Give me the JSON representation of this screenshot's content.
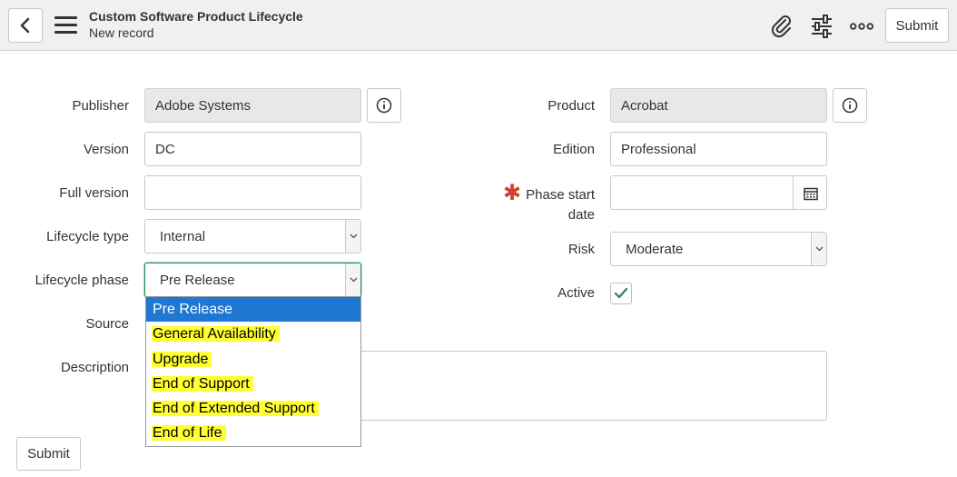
{
  "header": {
    "title": "Custom Software Product Lifecycle",
    "subtitle": "New record",
    "submit_label": "Submit"
  },
  "form": {
    "publisher": {
      "label": "Publisher",
      "value": "Adobe Systems"
    },
    "product": {
      "label": "Product",
      "value": "Acrobat"
    },
    "version": {
      "label": "Version",
      "value": "DC"
    },
    "edition": {
      "label": "Edition",
      "value": "Professional"
    },
    "full_version": {
      "label": "Full version",
      "value": ""
    },
    "phase_start_date": {
      "label_line1": "Phase start",
      "label_line2": "date",
      "value": ""
    },
    "lifecycle_type": {
      "label": "Lifecycle type",
      "value": "Internal"
    },
    "risk": {
      "label": "Risk",
      "value": "Moderate"
    },
    "lifecycle_phase": {
      "label": "Lifecycle phase",
      "value": "Pre Release",
      "options": [
        "Pre Release",
        "General Availability",
        "Upgrade",
        "End of Support",
        "End of Extended Support",
        "End of Life"
      ]
    },
    "active": {
      "label": "Active",
      "checked": true
    },
    "source": {
      "label": "Source"
    },
    "description": {
      "label": "Description",
      "value": ""
    },
    "submit_label": "Submit"
  },
  "icons": {
    "back": "chevron-left-icon",
    "menu": "hamburger-menu-icon",
    "attachment": "paperclip-icon",
    "settings": "sliders-icon",
    "more": "more-options-icon",
    "info": "info-icon",
    "calendar": "calendar-icon",
    "check": "checkmark-icon"
  },
  "colors": {
    "selected_option": "#1e78d2",
    "highlight": "#ffff33",
    "required_star": "#d13f2f",
    "checkmark": "#2e7d65"
  }
}
